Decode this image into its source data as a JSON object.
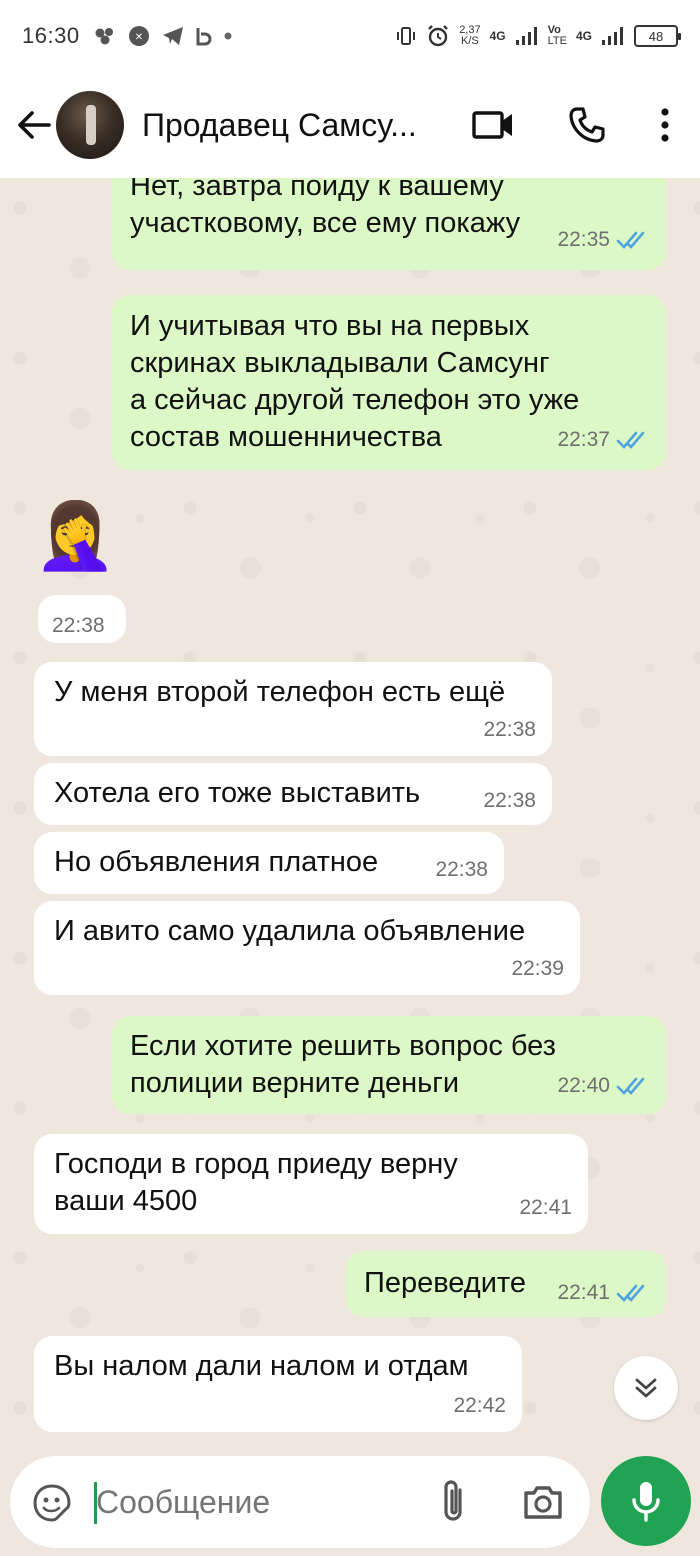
{
  "status_bar": {
    "time": "16:30",
    "speed_value": "2,37",
    "speed_unit": "K/S",
    "net1": "4G",
    "volte_top": "Vo",
    "volte_bottom": "LTE",
    "net2": "4G",
    "battery": "48"
  },
  "header": {
    "contact_name": "Продавец Самсу..."
  },
  "messages": [
    {
      "dir": "out",
      "text": "Нет, завтра поиду к вашему\nучастковому, все ему покажу",
      "time": "22:35"
    },
    {
      "dir": "out",
      "text": "И учитывая что вы на первых\nскринах выкладывали Самсунг\nа сейчас другой телефон это уже\nсостав мошенничества",
      "time": "22:37"
    },
    {
      "dir": "in",
      "text": "🤦‍♀️",
      "time": "22:38"
    },
    {
      "dir": "in",
      "text": "У меня второй телефон есть ещё",
      "time": "22:38"
    },
    {
      "dir": "in",
      "text": "Хотела его тоже выставить",
      "time": "22:38"
    },
    {
      "dir": "in",
      "text": "Но объявления платное",
      "time": "22:38"
    },
    {
      "dir": "in",
      "text": "И авито само удалила объявление",
      "time": "22:39"
    },
    {
      "dir": "out",
      "text": "Если хотите решить вопрос без\nполиции верните деньги",
      "time": "22:40"
    },
    {
      "dir": "in",
      "text": "Господи в город приеду верну\nваши 4500",
      "time": "22:41"
    },
    {
      "dir": "out",
      "text": "Переведите",
      "time": "22:41"
    },
    {
      "dir": "in",
      "text": "Вы налом дали налом и отдам",
      "time": "22:42"
    }
  ],
  "composer": {
    "placeholder": "Сообщение"
  },
  "colors": {
    "outgoing_bubble": "#dcf8c6",
    "incoming_bubble": "#ffffff",
    "read_ticks": "#4fa3e0",
    "mic_button": "#20a454",
    "chat_background": "#efe7de"
  }
}
